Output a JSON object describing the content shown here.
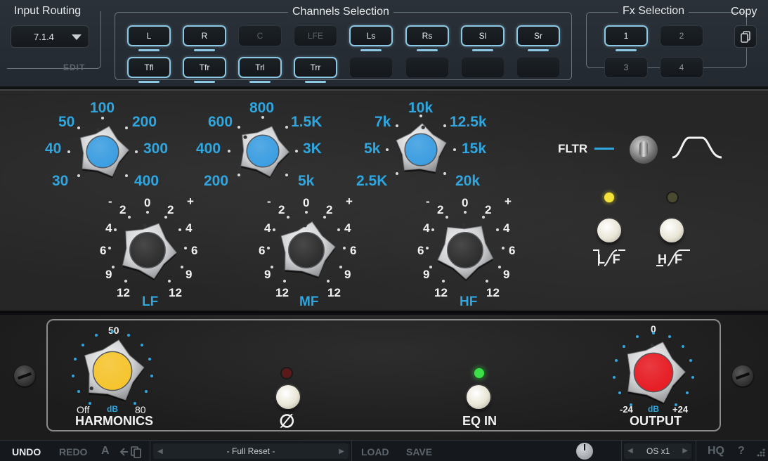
{
  "input_routing": {
    "title": "Input Routing",
    "value": "7.1.4",
    "edit_label": "EDIT"
  },
  "channels": {
    "title": "Channels Selection",
    "row1": [
      {
        "label": "L",
        "active": true
      },
      {
        "label": "R",
        "active": true
      },
      {
        "label": "C",
        "active": false
      },
      {
        "label": "LFE",
        "active": false
      },
      {
        "label": "Ls",
        "active": true
      },
      {
        "label": "Rs",
        "active": true
      },
      {
        "label": "Sl",
        "active": true
      },
      {
        "label": "Sr",
        "active": true
      }
    ],
    "row2": [
      {
        "label": "Tfl",
        "active": true
      },
      {
        "label": "Tfr",
        "active": true
      },
      {
        "label": "Trl",
        "active": true
      },
      {
        "label": "Trr",
        "active": true
      }
    ]
  },
  "fx_selection": {
    "title": "Fx Selection",
    "slots": [
      "1",
      "2",
      "3",
      "4"
    ],
    "selected": "1"
  },
  "copy": {
    "label": "Copy"
  },
  "eq": {
    "lf_freq": {
      "labels": [
        "30",
        "40",
        "50",
        "100",
        "200",
        "300",
        "400"
      ]
    },
    "mf_freq": {
      "labels": [
        "200",
        "400",
        "600",
        "800",
        "1.5K",
        "3K",
        "5k"
      ]
    },
    "hf_freq": {
      "labels": [
        "2.5K",
        "5k",
        "7k",
        "10k",
        "12.5k",
        "15k",
        "20k"
      ]
    },
    "gain_scale": {
      "minus": "-",
      "plus": "+",
      "zero": "0",
      "steps": [
        "2",
        "4",
        "6",
        "9",
        "12"
      ]
    },
    "band_labels": {
      "lf": "LF",
      "mf": "MF",
      "hf": "HF"
    },
    "filter": {
      "label": "FLTR",
      "lf_label": "L F",
      "hf_label": "H F",
      "lf_led": "#f2e23a",
      "hf_led": "#4a4a30"
    }
  },
  "bottom_section": {
    "harmonics": {
      "label": "HARMONICS",
      "max_mark": "50",
      "min": "Off",
      "max": "80",
      "unit": "dB",
      "knob_color": "#f7c52c"
    },
    "phase": {
      "symbol": "∅",
      "led_color": "#5a1a1a"
    },
    "eq_in": {
      "label": "EQ IN",
      "led_color": "#3ee04a"
    },
    "output": {
      "label": "OUTPUT",
      "top": "0",
      "min": "-24",
      "max": "+24",
      "unit": "dB",
      "knob_color": "#e81a22"
    }
  },
  "toolbar": {
    "undo": "UNDO",
    "redo": "REDO",
    "ab": "A",
    "preset": "- Full Reset -",
    "load": "LOAD",
    "save": "SAVE",
    "os": "OS x1",
    "hq": "HQ",
    "help": "?"
  },
  "colors": {
    "accent": "#2fa6df",
    "active_outline": "#8cc8e3"
  }
}
